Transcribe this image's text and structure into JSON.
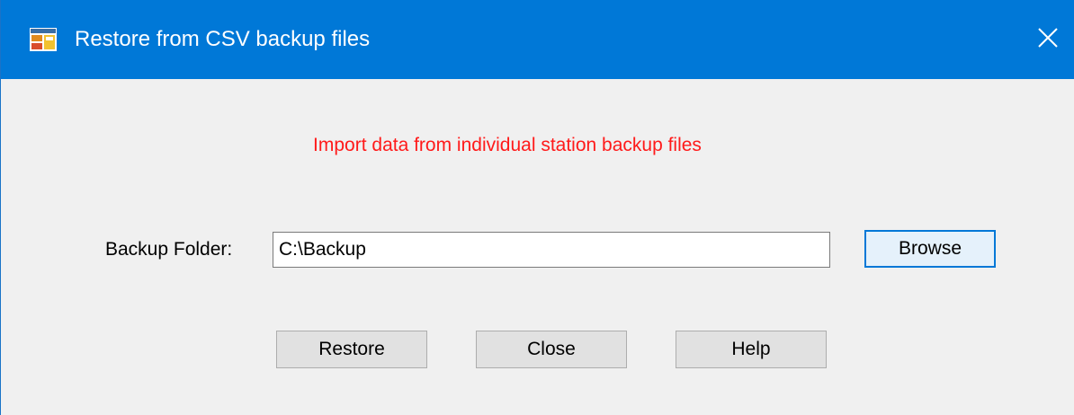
{
  "window": {
    "title": "Restore from CSV backup files",
    "icon": "app-window-icon",
    "close_glyph": "✕",
    "titlebar_color": "#0078d7"
  },
  "content": {
    "headline": "Import data from individual station backup files",
    "headline_color": "#ff1a1a",
    "folder_label": "Backup Folder:",
    "folder_value": "C:\\Backup",
    "browse_label": "Browse"
  },
  "actions": {
    "restore_label": "Restore",
    "close_label": "Close",
    "help_label": "Help"
  }
}
